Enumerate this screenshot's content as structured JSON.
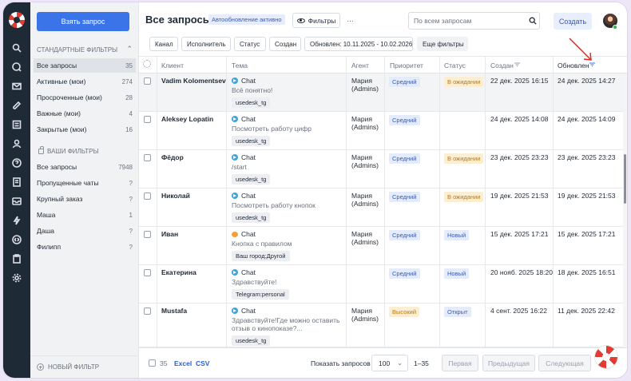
{
  "colors": {
    "accent": "#3b74e8",
    "rail": "#1f2a37",
    "annotation_arrow": "#e2231a"
  },
  "rail_icons": [
    "logo-icon",
    "search-icon",
    "chat-search-icon",
    "mail-icon",
    "edit-icon",
    "list-icon",
    "user-icon",
    "help-icon",
    "doc-icon",
    "inbox-icon",
    "bolt-icon",
    "code-icon",
    "clipboard-icon",
    "settings-icon"
  ],
  "sidebar": {
    "take_request": "Взять запрос",
    "standard_header": "СТАНДАРТНЫЕ ФИЛЬТРЫ",
    "standard": [
      {
        "label": "Все запросы",
        "count": "35",
        "active": true
      },
      {
        "label": "Активные (мои)",
        "count": "274"
      },
      {
        "label": "Просроченные (мои)",
        "count": "28"
      },
      {
        "label": "Важные (мои)",
        "count": "4"
      },
      {
        "label": "Закрытые (мои)",
        "count": "16"
      }
    ],
    "my_header": "ВАШИ ФИЛЬТРЫ",
    "mine": [
      {
        "label": "Все запросы",
        "count": "7948"
      },
      {
        "label": "Пропущенные чаты",
        "count": "?"
      },
      {
        "label": "Крупный заказ",
        "count": "?"
      },
      {
        "label": "Маша",
        "count": "1"
      },
      {
        "label": "Даша",
        "count": "?"
      },
      {
        "label": "Филипп",
        "count": "?"
      }
    ],
    "new_filter": "НОВЫЙ ФИЛЬТР"
  },
  "header": {
    "title": "Все запросы",
    "auto_badge": "Автообновление активно",
    "filters_btn": "Фильтры",
    "more_btn": "···",
    "search_placeholder": "По всем запросам",
    "create_btn": "Создать"
  },
  "chips": {
    "channel": "Канал",
    "assignee": "Исполнитель",
    "status": "Статус",
    "created": "Создан",
    "updated_range": "Обновлен: 10.11.2025 - 10.02.2026",
    "more_filters": "Еще фильтры"
  },
  "columns": {
    "client": "Клиент",
    "topic": "Тема",
    "agent": "Агент",
    "priority": "Приоритет",
    "status": "Статус",
    "created": "Создан",
    "updated": "Обновлен"
  },
  "rows": [
    {
      "client": "Vadim Kolomentsev",
      "channel": "Chat",
      "message": "Всё понятно!",
      "tag": "usedesk_tg",
      "agent_1": "Мария",
      "agent_2": "(Admins)",
      "priority": "Средний",
      "status": "В ожидании",
      "created": "22 дек. 2025 16:15",
      "updated": "24 дек. 2025 14:27"
    },
    {
      "client": "Aleksey Lopatin",
      "channel": "Chat",
      "message": "Посмотреть работу цифр",
      "tag": "usedesk_tg",
      "agent_1": "Мария",
      "agent_2": "(Admins)",
      "priority": "Средний",
      "status": "",
      "created": "24 дек. 2025 14:08",
      "updated": "24 дек. 2025 14:09"
    },
    {
      "client": "Фёдор",
      "channel": "Chat",
      "message": "/start",
      "tag": "usedesk_tg",
      "agent_1": "Мария",
      "agent_2": "(Admins)",
      "priority": "Средний",
      "status": "В ожидании",
      "created": "23 дек. 2025 23:23",
      "updated": "23 дек. 2025 23:23"
    },
    {
      "client": "Николай",
      "channel": "Chat",
      "message": "Посмотреть работу кнопок",
      "tag": "usedesk_tg",
      "agent_1": "Мария",
      "agent_2": "(Admins)",
      "priority": "Средний",
      "status": "В ожидании",
      "created": "19 дек. 2025 21:53",
      "updated": "19 дек. 2025 21:53"
    },
    {
      "client": "Иван",
      "channel": "Chat",
      "message": "Кнопка с правилом",
      "tag": "Ваш город:Другой",
      "agent_1": "Мария",
      "agent_2": "(Admins)",
      "priority": "Средний",
      "status": "Новый",
      "created": "15 дек. 2025 17:21",
      "updated": "15 дек. 2025 17:21"
    },
    {
      "client": "Екатерина",
      "channel": "Chat",
      "message": "Здравствуйте!",
      "tag": "Telegram:personal",
      "agent_1": "",
      "agent_2": "",
      "priority": "Средний",
      "status": "Новый",
      "created": "20 нояб. 2025 18:20",
      "updated": "18 дек. 2025 16:51"
    },
    {
      "client": "Mustafa",
      "channel": "Chat",
      "message": "Здравствуйте!Где можно оставить отзыв о кинопоказе?...",
      "tag": "usedesk_tg",
      "agent_1": "Мария",
      "agent_2": "(Admins)",
      "priority": "Высокий",
      "status": "Открыт",
      "created": "4 сент. 2025 16:22",
      "updated": "11 дек. 2025 22:42"
    }
  ],
  "footer": {
    "count": "35",
    "excel": "Excel",
    "csv": "CSV",
    "show_label": "Показать запросов",
    "page_size": "100",
    "range": "1–35",
    "first": "Первая",
    "prev": "Предыдущая",
    "next": "Следующая"
  }
}
